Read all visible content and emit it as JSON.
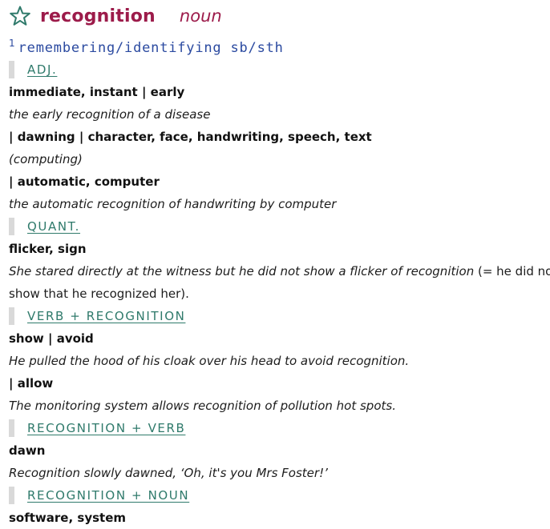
{
  "entry": {
    "headword": "recognition",
    "pos": "noun",
    "sense_number": "1",
    "sense": "remembering/identifying sb/sth"
  },
  "sections": {
    "adj": {
      "label": "ADJ.",
      "coll1": "immediate, instant | early",
      "ex1": "the early recognition of a disease",
      "coll2": "| dawning | character, face, handwriting, speech, text",
      "note2": "(computing)",
      "coll3": "| automatic, computer",
      "ex3": "the automatic recognition of handwriting by computer"
    },
    "quant": {
      "label": "QUANT.",
      "coll1": "flicker, sign",
      "ex1_italic": "She stared directly at the witness but he did not show a flicker of recognition",
      "ex1_gloss": " (= he did not",
      "ex1_cont": "show that he recognized her)."
    },
    "verb_rec": {
      "label": "VERB + RECOGNITION",
      "coll1": "show | avoid",
      "ex1": "He pulled the hood of his cloak over his head to avoid recognition.",
      "coll2": "| allow",
      "ex2": "The monitoring system allows recognition of pollution hot spots."
    },
    "rec_verb": {
      "label": "RECOGNITION + VERB",
      "coll1": "dawn",
      "ex1": "Recognition slowly dawned, ‘Oh, it's you Mrs Foster!’"
    },
    "rec_noun": {
      "label": "RECOGNITION + NOUN",
      "coll1": "software, system"
    }
  },
  "colors": {
    "headword": "#9c1b4a",
    "sense": "#2b4aa0",
    "category": "#2f7a6b",
    "category_bar": "#d9d9d9"
  }
}
